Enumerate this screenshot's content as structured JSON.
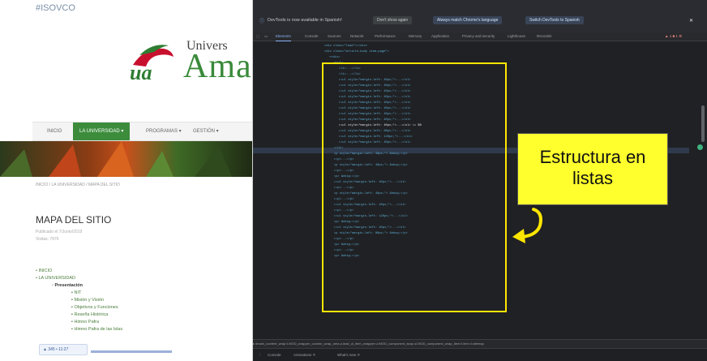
{
  "site": {
    "url_text": "#ISOVCO",
    "logo_text_small": "Univers",
    "logo_text_big": "Ama",
    "nav": [
      "INICIO",
      "LA UNIVERSIDAD ▾",
      "PROGRAMAS ▾",
      "GESTIÓN ▾"
    ],
    "breadcrumb": "INICIO / LA UNIVERSIDAD / MAPA DEL SITIO",
    "page_title": "MAPA DEL SITIO",
    "meta_lines": [
      "Publicado el 7/Junio/2019",
      "Visitas: 7876"
    ],
    "sitemap_items": [
      "• INICIO",
      "• LA UNIVERSIDAD",
      "◦ Presentación",
      "▪ NIT",
      "▪ Misión y Visión",
      "▪ Objetivos y Funciones",
      "▪ Reseña Histórica",
      "▪ Himno Pafra",
      "▪ Himno Pafra de las Islas"
    ],
    "float_button": "▲ 345 • 11:27"
  },
  "devtools": {
    "banner_text": "DevTools is now available in Spanish!",
    "banner_buttons": [
      "Don't show again",
      "Always match Chrome's language",
      "Switch DevTools to Spanish"
    ],
    "tabs": [
      "Elements",
      "Console",
      "Sources",
      "Network",
      "Performance",
      "Memory",
      "Application",
      "Privacy and security",
      "Lighthouse",
      "Recorder"
    ],
    "active_tab": "Elements",
    "issues_badge": "▲ 1  ■ 1  ⚙",
    "breadcrumbs": "▸ #main_content_wrap  li.MOD_wrapper_column_wrap_area  p.lead_ul_item_wrapper  ul.MOD_component_wrap  ul.MOD_component_wrap_item  li.item  li.sitemap",
    "drawer_tabs": [
      "Console",
      "Animations ✕",
      "What's new ✕"
    ],
    "code_lines": [
      {
        "indent": 0,
        "text": "<div class=\"lead\"></div>"
      },
      {
        "indent": 0,
        "text": "<div class=\"article-body item-page\">"
      },
      {
        "indent": 1,
        "text": "▾<div>"
      },
      {
        "indent": 2,
        "text": "▾<ul>"
      },
      {
        "indent": 3,
        "text": "<li>...</li>"
      },
      {
        "indent": 3,
        "text": "<li>...</li>"
      },
      {
        "indent": 3,
        "text": "▸<ul style=\"margin-left: 40px;\">...</ul>"
      },
      {
        "indent": 3,
        "text": "▸<ul style=\"margin-left: 40px;\">...</ul>"
      },
      {
        "indent": 3,
        "text": "▸<ul style=\"margin-left: 40px;\">...</ul>"
      },
      {
        "indent": 3,
        "text": "▸<ul style=\"margin-left: 40px;\">...</ul>"
      },
      {
        "indent": 3,
        "text": "▸<ul style=\"margin-left: 40px;\">...</ul>"
      },
      {
        "indent": 3,
        "text": "▸<ul style=\"margin-left: 40px;\">...</ul>"
      },
      {
        "indent": 3,
        "text": "▸<ul style=\"margin-left: 40px;\">...</ul>"
      },
      {
        "indent": 3,
        "text": "▸<ul style=\"margin-left: 40px;\">...</ul>"
      },
      {
        "indent": 3,
        "text": "▸<ul style=\"margin-left: 40px;\">...</ul> == $0"
      },
      {
        "indent": 3,
        "text": "▸<ul style=\"margin-left: 80px;\">...</ul>"
      },
      {
        "indent": 3,
        "text": "▸<ul style=\"margin-left: 120px;\">...</ul>"
      },
      {
        "indent": 3,
        "text": "▸<ul style=\"margin-left: 40px;\">...</ul>"
      },
      {
        "indent": 2,
        "text": "</ul>"
      },
      {
        "indent": 2,
        "text": "<p style=\"margin-left: 40px;\"> &nbsp;</p>"
      },
      {
        "indent": 2,
        "text": "▸<p>...</p>"
      },
      {
        "indent": 2,
        "text": "<p style=\"margin-left: 40px;\"> &nbsp;</p>"
      },
      {
        "indent": 2,
        "text": "▸<p>...</p>"
      },
      {
        "indent": 2,
        "text": "<p> &nbsp;</p>"
      },
      {
        "indent": 2,
        "text": "▸<ul style=\"margin-left: 40px;\">...</ul>"
      },
      {
        "indent": 2,
        "text": "▸<p>...</p>"
      },
      {
        "indent": 2,
        "text": "<p style=\"margin-left: 40px;\"> &nbsp;</p>"
      },
      {
        "indent": 2,
        "text": "▸<p>...</p>"
      },
      {
        "indent": 2,
        "text": "▸<ul style=\"margin-left: 40px;\">...</ul>"
      },
      {
        "indent": 2,
        "text": "▸<p>...</p>"
      },
      {
        "indent": 2,
        "text": "▸<ul style=\"margin-left: 120px;\">...</ul>"
      },
      {
        "indent": 2,
        "text": "<p> &nbsp;</p>"
      },
      {
        "indent": 2,
        "text": "▸<ul style=\"margin-left: 40px;\">...</ul>"
      },
      {
        "indent": 2,
        "text": "<p style=\"margin-left: 80px;\"> &nbsp;</p>"
      },
      {
        "indent": 2,
        "text": "▸<p>...</p>"
      },
      {
        "indent": 2,
        "text": "<p> &nbsp;</p>"
      },
      {
        "indent": 2,
        "text": "▸<p>...</p>"
      },
      {
        "indent": 2,
        "text": "<p> &nbsp;</p>"
      }
    ]
  },
  "annotation": {
    "callout_text": "Estructura en listas",
    "highlight_color": "#ffe600",
    "callout_bg": "#ffff2e"
  }
}
